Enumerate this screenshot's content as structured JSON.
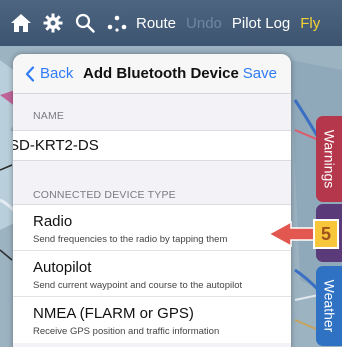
{
  "toolbar": {
    "route": "Route",
    "undo": "Undo",
    "pilot_log": "Pilot Log",
    "fly": "Fly"
  },
  "modal": {
    "back": "Back",
    "title": "Add Bluetooth Device",
    "save": "Save",
    "name_header": "NAME",
    "name_value": "SD-KRT2-DS",
    "type_header": "CONNECTED DEVICE TYPE",
    "device_types": [
      {
        "title": "Radio",
        "subtitle": "Send frequencies to the radio by tapping them"
      },
      {
        "title": "Autopilot",
        "subtitle": "Send current waypoint and course to the autopilot"
      },
      {
        "title": "NMEA (FLARM or GPS)",
        "subtitle": "Receive GPS position and traffic information"
      }
    ]
  },
  "side_tabs": {
    "warnings": "Warnings",
    "weather": "Weather"
  },
  "callout": {
    "number": "5"
  },
  "colors": {
    "accent_blue": "#2f7cf6",
    "toolbar_bg": "#4d6580",
    "fly_yellow": "#f5d235",
    "callout_red": "#e2574f",
    "callout_badge": "#f7c63a"
  }
}
